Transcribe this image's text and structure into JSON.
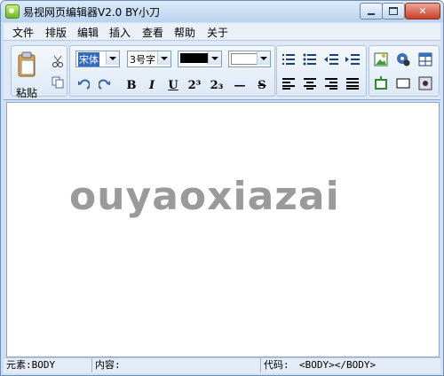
{
  "window": {
    "title": "易视网页编辑器V2.0 BY小刀"
  },
  "menu": [
    "文件",
    "排版",
    "编辑",
    "插入",
    "查看",
    "帮助",
    "关于"
  ],
  "toolbar": {
    "paste_label": "粘贴",
    "font_name": "宋体",
    "font_size": "3号字",
    "fore_color": "#000000",
    "back_color": "#ffffff",
    "format_buttons": [
      "B",
      "I",
      "U",
      "2³",
      "2₃",
      "—",
      "S"
    ]
  },
  "editor": {
    "watermark": "ouyaoxiazai"
  },
  "status": {
    "element_label": "元素:BODY",
    "content_label": "内容:",
    "code_label": "代码:",
    "code_value": "<BODY></BODY>"
  }
}
